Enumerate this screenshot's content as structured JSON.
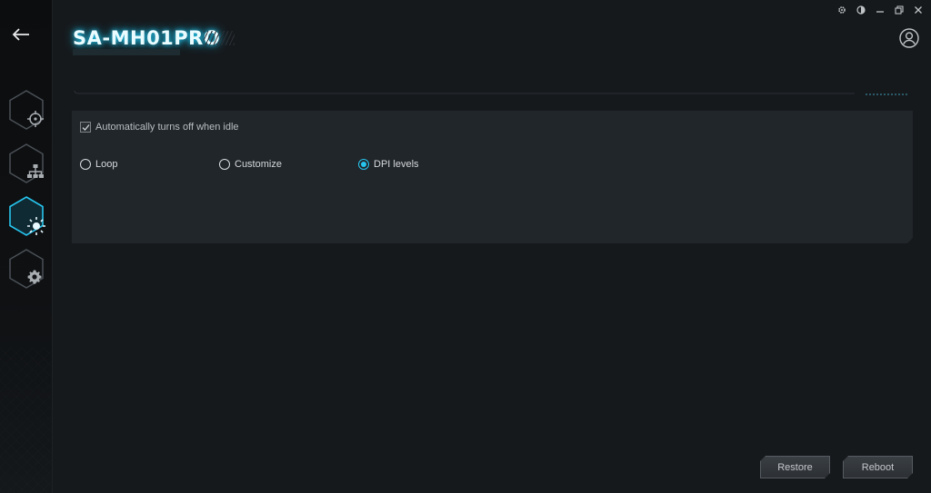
{
  "app": {
    "title": "SA-MH01PRO"
  },
  "sidebar": {
    "back_icon": "arrow-left-icon",
    "items": [
      {
        "name": "crosshair-icon",
        "active": false
      },
      {
        "name": "network-hierarchy-icon",
        "active": false
      },
      {
        "name": "lighting-sun-icon",
        "active": true
      },
      {
        "name": "gear-icon",
        "active": false
      }
    ]
  },
  "window_controls": [
    "settings-gear-icon",
    "theme-contrast-icon",
    "minimize-icon",
    "restore-icon",
    "close-icon"
  ],
  "settings": {
    "idle_checkbox": {
      "label": "Automatically turns off when idle",
      "checked": true
    },
    "modes": [
      {
        "label": "Loop",
        "selected": false
      },
      {
        "label": "Customize",
        "selected": false
      },
      {
        "label": "DPI levels",
        "selected": true
      }
    ]
  },
  "footer": {
    "restore_label": "Restore",
    "reboot_label": "Reboot"
  },
  "colors": {
    "accent": "#27c5ee",
    "background": "#16191c",
    "panel": "#21262a"
  }
}
